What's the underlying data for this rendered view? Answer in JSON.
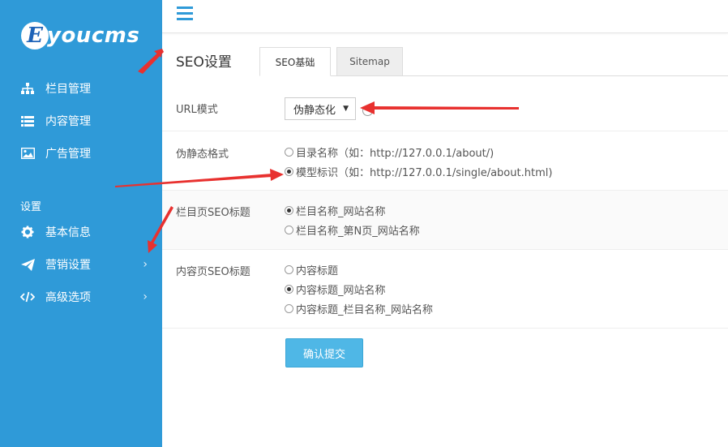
{
  "brand": {
    "logo_letter": "E",
    "logo_text": "youcms"
  },
  "sidebar": {
    "items": [
      {
        "label": "栏目管理",
        "icon": "sitemap-icon"
      },
      {
        "label": "内容管理",
        "icon": "list-icon"
      },
      {
        "label": "广告管理",
        "icon": "image-icon"
      }
    ],
    "section_label": "设置",
    "settings_items": [
      {
        "label": "基本信息",
        "icon": "gear-icon"
      },
      {
        "label": "营销设置",
        "icon": "paper-plane-icon",
        "chevron": "›"
      },
      {
        "label": "高级选项",
        "icon": "code-icon",
        "chevron": "›"
      }
    ]
  },
  "page": {
    "title": "SEO设置"
  },
  "tabs": [
    {
      "label": "SEO基础",
      "active": true
    },
    {
      "label": "Sitemap",
      "active": false
    }
  ],
  "form": {
    "url_mode": {
      "label": "URL模式",
      "value": "伪静态化",
      "caret": "▼"
    },
    "pseudo_format": {
      "label": "伪静态格式",
      "options": [
        {
          "label": "目录名称（如：http://127.0.0.1/about/)",
          "checked": false
        },
        {
          "label": "模型标识（如：http://127.0.0.1/single/about.html)",
          "checked": true
        }
      ]
    },
    "column_seo_title": {
      "label": "栏目页SEO标题",
      "options": [
        {
          "label": "栏目名称_网站名称",
          "checked": true
        },
        {
          "label": "栏目名称_第N页_网站名称",
          "checked": false
        }
      ]
    },
    "content_seo_title": {
      "label": "内容页SEO标题",
      "options": [
        {
          "label": "内容标题",
          "checked": false
        },
        {
          "label": "内容标题_网站名称",
          "checked": true
        },
        {
          "label": "内容标题_栏目名称_网站名称",
          "checked": false
        }
      ]
    },
    "submit_label": "确认提交"
  },
  "colors": {
    "sidebar": "#2f9ad8",
    "accent": "#4fb7e6",
    "annotation_arrow": "#e8312f"
  }
}
